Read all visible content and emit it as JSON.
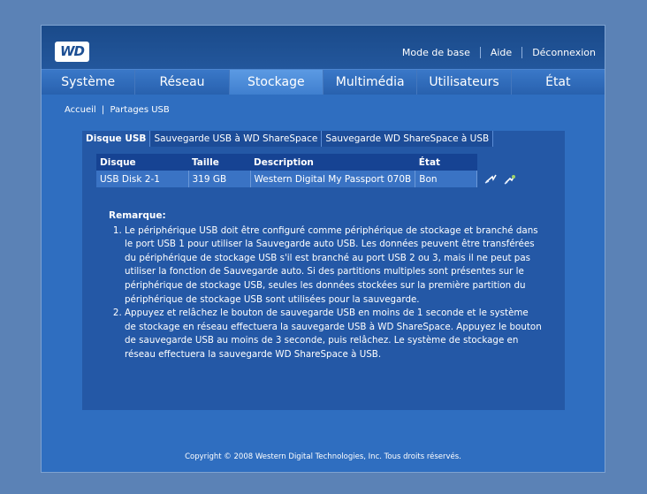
{
  "header": {
    "logo": "WD",
    "links": [
      "Mode de base",
      "Aide",
      "Déconnexion"
    ]
  },
  "nav": {
    "tabs": [
      "Système",
      "Réseau",
      "Stockage",
      "Multimédia",
      "Utilisateurs",
      "État"
    ],
    "active": "Stockage"
  },
  "breadcrumb": {
    "home": "Accueil",
    "separator": "|",
    "current": "Partages USB"
  },
  "subtabs": [
    "Disque USB",
    "Sauvegarde USB à WD ShareSpace",
    "Sauvegarde WD ShareSpace à USB"
  ],
  "table": {
    "headers": [
      "Disque",
      "Taille",
      "Description",
      "État"
    ],
    "rows": [
      [
        "USB Disk 2-1",
        "319 GB",
        "Western Digital My Passport 070B",
        "Bon"
      ]
    ],
    "row_icons": [
      "eject-icon",
      "backup-icon"
    ]
  },
  "notes": {
    "title": "Remarque:",
    "items": [
      "Le périphérique USB doit être configuré comme périphérique de stockage et branché dans le port USB 1 pour utiliser la Sauvegarde auto USB. Les données peuvent être transférées du périphérique de stockage USB s'il est branché au port USB 2 ou 3, mais il ne peut pas utiliser la fonction de Sauvegarde auto. Si des partitions multiples sont présentes sur le périphérique de stockage USB, seules les données stockées sur la première partition du périphérique de stockage USB sont utilisées pour la sauvegarde.",
      "Appuyez et relâchez le bouton de sauvegarde USB en moins de 1 seconde et le système de stockage en réseau effectuera la sauvegarde USB à WD ShareSpace. Appuyez le bouton de sauvegarde USB au moins de 3 seconde, puis relâchez. Le système de stockage en réseau effectuera la sauvegarde WD ShareSpace à USB."
    ]
  },
  "footer": "Copyright © 2008 Western Digital Technologies, Inc. Tous droits réservés.",
  "colors": {
    "page_bg": "#5b82b6",
    "frame_bg": "#2f6ec0",
    "panel_bg": "#2458a6",
    "header_bg": "#1a4a8a"
  }
}
